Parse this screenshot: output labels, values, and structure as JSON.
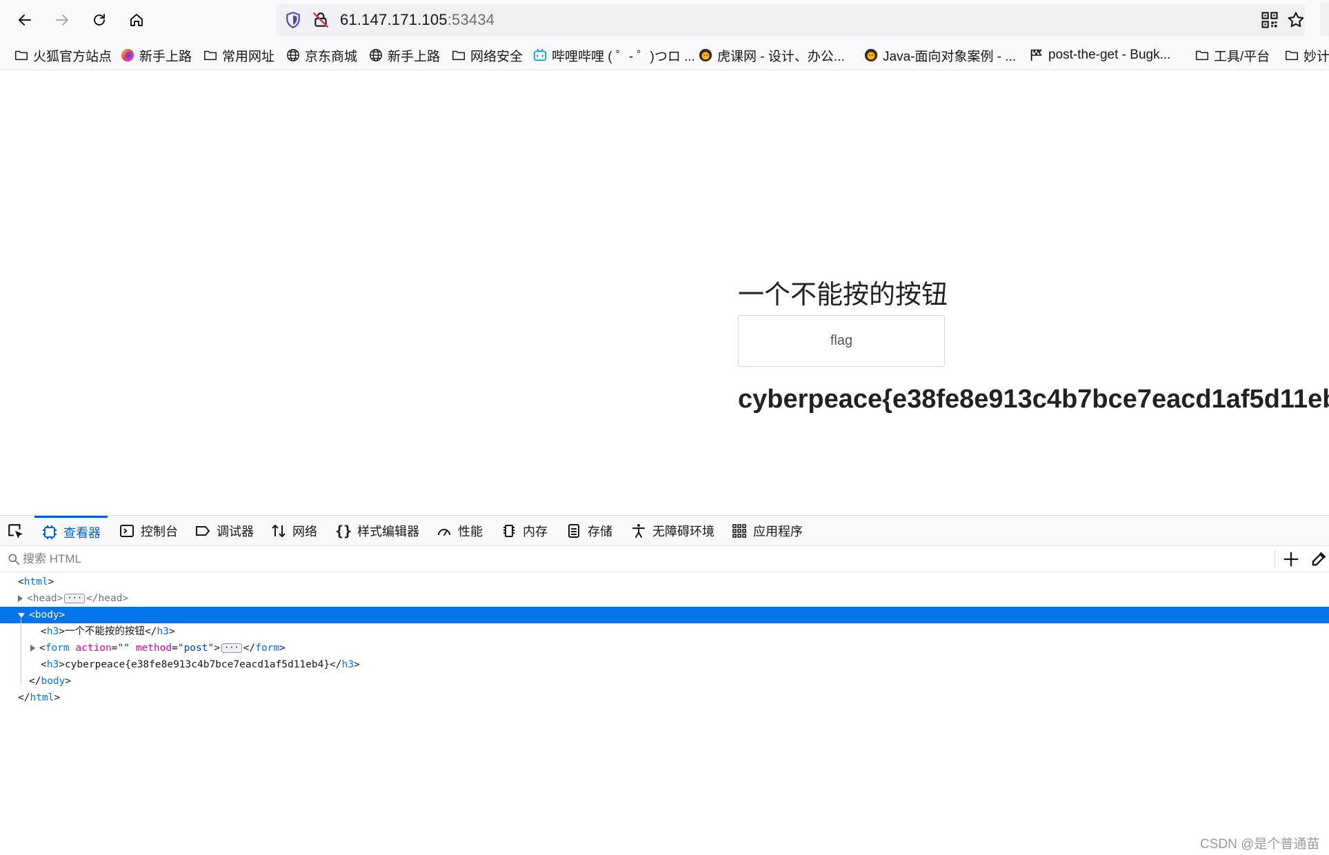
{
  "browser": {
    "url_host": "61.147.171.105",
    "url_port": ":53434"
  },
  "bookmarks": [
    {
      "label": "火狐官方站点",
      "icon": "folder-icon"
    },
    {
      "label": "新手上路",
      "icon": "firefox-icon"
    },
    {
      "label": "常用网址",
      "icon": "folder-icon"
    },
    {
      "label": "京东商城",
      "icon": "globe-icon"
    },
    {
      "label": "新手上路",
      "icon": "globe-icon"
    },
    {
      "label": "网络安全",
      "icon": "folder-icon"
    },
    {
      "label": "哔哩哔哩 ( ゜- ゜)つロ ...",
      "icon": "bilibili-icon"
    },
    {
      "label": "虎课网 - 设计、办公...",
      "icon": "hukewang-icon"
    },
    {
      "label": "Java-面向对象案例 - ...",
      "icon": "hukewang-icon"
    },
    {
      "label": "post-the-get - Bugk...",
      "icon": "flag-icon"
    },
    {
      "label": "工具/平台",
      "icon": "folder-icon"
    },
    {
      "label": "妙计",
      "icon": "folder-icon"
    }
  ],
  "page": {
    "title": "一个不能按的按钮",
    "button_label": "flag",
    "flag_text": "cyberpeace{e38fe8e913c4b7bce7eacd1af5d11eb4}"
  },
  "devtools": {
    "tabs": [
      {
        "label": "查看器",
        "icon": "inspector-icon",
        "active": true
      },
      {
        "label": "控制台",
        "icon": "console-icon"
      },
      {
        "label": "调试器",
        "icon": "debugger-icon"
      },
      {
        "label": "网络",
        "icon": "network-icon"
      },
      {
        "label": "样式编辑器",
        "icon": "style-editor-icon"
      },
      {
        "label": "性能",
        "icon": "performance-icon"
      },
      {
        "label": "内存",
        "icon": "memory-icon"
      },
      {
        "label": "存储",
        "icon": "storage-icon"
      },
      {
        "label": "无障碍环境",
        "icon": "accessibility-icon"
      },
      {
        "label": "应用程序",
        "icon": "application-icon"
      }
    ],
    "search_placeholder": "搜索 HTML",
    "tree": {
      "html_open": "html",
      "head": "head",
      "body": "body",
      "h3_title_text": "一个不能按的按钮",
      "h3_tag": "h3",
      "form_tag": "form",
      "form_attr_action": "action",
      "form_attr_action_val": "\"\"",
      "form_attr_method": "method",
      "form_attr_method_val": "\"post\"",
      "h3_flag_text": "cyberpeace{e38fe8e913c4b7bce7eacd1af5d11eb4}"
    }
  },
  "watermark": "CSDN @是个普通苗",
  "colors": {
    "accent": "#0061e0",
    "selected_row": "#0074e8",
    "tag": "#0074e8",
    "attr": "#dd00a9",
    "attr_value": "#003eaa"
  }
}
